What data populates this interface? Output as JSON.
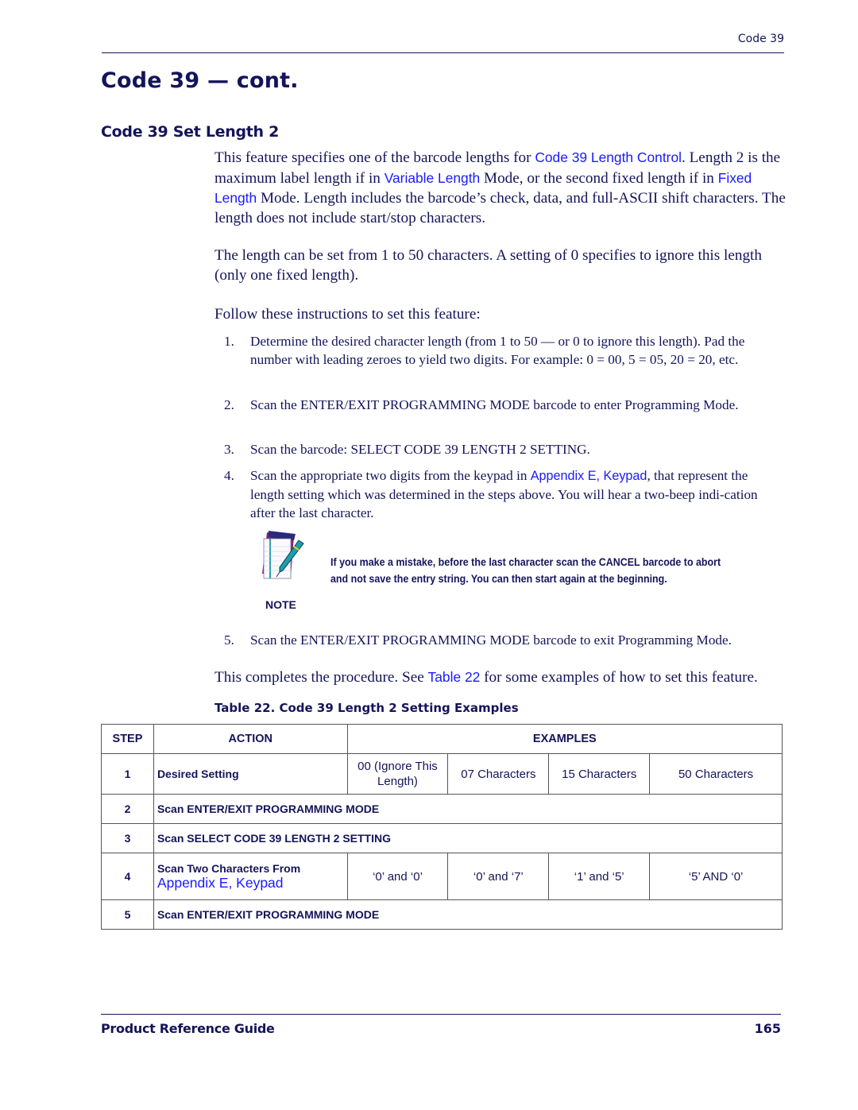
{
  "header": {
    "running_title": "Code 39"
  },
  "page_title": "Code 39 — cont.",
  "section_title": "Code 39 Set Length 2",
  "intro": {
    "p1_a": "This feature specifies one of the barcode lengths for ",
    "p1_link1": "Code 39 Length Control",
    "p1_b": ". Length 2 is the maximum label length if in ",
    "p1_link2": "Variable Length",
    "p1_c": " Mode, or the second fixed length if in ",
    "p1_link3": "Fixed Length",
    "p1_d": " Mode. Length includes the barcode’s check, data, and full-ASCII shift characters.  The length does not include start/stop characters.",
    "p2": "The length can be set from 1 to 50 characters. A setting of 0 specifies to ignore this length (only one fixed length).",
    "p3": "Follow these instructions to set this feature:"
  },
  "steps": [
    {
      "num": "1.",
      "text": "Determine the desired character length (from 1 to 50 — or 0 to ignore this length). Pad the number with leading zeroes to yield two digits. For example: 0 = 00, 5 = 05, 20 = 20, etc."
    },
    {
      "num": "2.",
      "text": "Scan the ENTER/EXIT PROGRAMMING MODE barcode to enter Programming Mode."
    },
    {
      "num": "3.",
      "text": "Scan the barcode: SELECT CODE 39 LENGTH 2 SETTING."
    },
    {
      "num": "4.",
      "text_a": "Scan the appropriate two digits from the keypad in ",
      "link": "Appendix E, Keypad",
      "text_b": ", that represent the length setting which was determined in the steps above. You will hear a two-beep indi-cation after the last character."
    },
    {
      "num": "5.",
      "text": "Scan the ENTER/EXIT PROGRAMMING MODE barcode to exit Programming Mode."
    }
  ],
  "note": {
    "label": "NOTE",
    "icon": "notepad-pen-icon",
    "text": "If you make a mistake, before the last character scan the CANCEL barcode to abort and not save the entry string. You can then start again at the beginning."
  },
  "conclusion": {
    "a": "This completes the procedure. See ",
    "link": "Table 22",
    "b": " for some examples of how to set this feature."
  },
  "table": {
    "caption": "Table 22. Code 39 Length 2 Setting Examples",
    "headers": {
      "step": "STEP",
      "action": "ACTION",
      "examples": "EXAMPLES"
    },
    "rows": [
      {
        "step": "1",
        "action": "Desired Setting",
        "examples": [
          "00 (Ignore This Length)",
          "07 Characters",
          "15 Characters",
          "50 Characters"
        ]
      },
      {
        "step": "2",
        "action": "Scan ENTER/EXIT PROGRAMMING MODE"
      },
      {
        "step": "3",
        "action": "Scan SELECT CODE 39 LENGTH 2 SETTING"
      },
      {
        "step": "4",
        "action": "Scan Two Characters From",
        "action_link": "Appendix E, Keypad",
        "examples": [
          "‘0’ and ‘0’",
          "‘0’ and ‘7’",
          "‘1’ and ‘5’",
          "‘5’ AND ‘0’"
        ]
      },
      {
        "step": "5",
        "action": "Scan ENTER/EXIT PROGRAMMING MODE"
      }
    ]
  },
  "footer": {
    "title": "Product Reference Guide",
    "page": "165"
  },
  "colors": {
    "text": "#14145a",
    "link": "#1a1aff"
  }
}
